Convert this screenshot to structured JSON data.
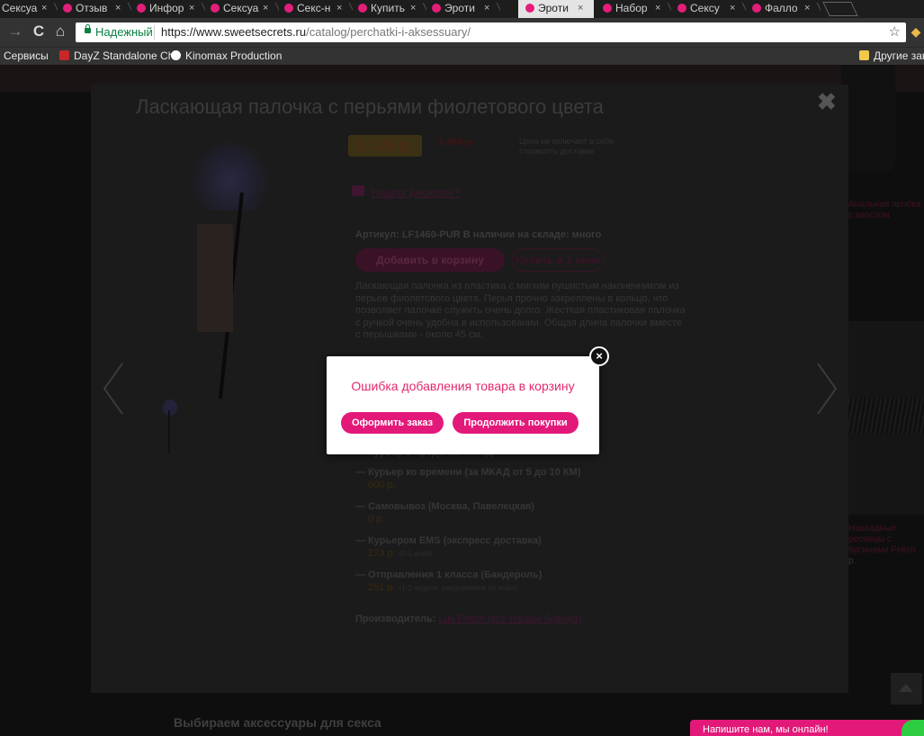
{
  "browser": {
    "tabs": [
      {
        "label": "Сексуа",
        "active": false
      },
      {
        "label": "Отзыв",
        "active": false
      },
      {
        "label": "Инфор",
        "active": false
      },
      {
        "label": "Сексуа",
        "active": false
      },
      {
        "label": "Секс-н",
        "active": false
      },
      {
        "label": "Купить",
        "active": false
      },
      {
        "label": "Эроти",
        "active": false
      },
      {
        "label": "Эроти",
        "active": true
      },
      {
        "label": "Набор",
        "active": false
      },
      {
        "label": "Сексу",
        "active": false
      },
      {
        "label": "Фалло",
        "active": false
      }
    ],
    "tab_close_glyph": "×",
    "nav": {
      "back": "→",
      "reload": "C",
      "home": "⌂"
    },
    "address": {
      "secure_label": "Надежный",
      "url_host": "https://www.sweetsecrets.ru",
      "url_path": "/catalog/perchatki-i-aksessuary/",
      "star": "☆"
    },
    "bookmarks": [
      {
        "label": "Сервисы",
        "icon": "apps-icon",
        "color": "#333333"
      },
      {
        "label": "DayZ Standalone Che",
        "icon": "dayz-icon",
        "color": "#c62828"
      },
      {
        "label": "Kinomax Production",
        "icon": "kinomax-icon",
        "color": "#ffffff"
      }
    ],
    "other_bookmarks": "Другие закл"
  },
  "quickview": {
    "title": "Ласкающая палочка с перьями фиолетового цвета",
    "close_glyph": "✖",
    "price": "1 125 р.",
    "old_price": "1 250 р.",
    "price_note": "Цена не включает в себя стоимость доставки",
    "cheaper_link": "Нашли дешевле?",
    "article": "Артикул: LF1460-PUR   В наличии на складе: много",
    "add_to_cart": "Добавить в корзину",
    "buy_one_click": "Купить в 1 клик",
    "description": "Ласкающая палочка из пластика с мягким пушистым наконечником из перьев фиолетового цвета. Перья прочно закреплены в кольцо, что позволяет палочке служить очень долго. Жесткая пластиковая палочка с ручкой очень удобна в использовании. Общая длина палочки вместе с перышками - около 45 см.",
    "delivery_partial": "— Курьер в пределах МКАД",
    "delivery": [
      {
        "name": "— Курьер ко времени (за МКАД от 5 до 10 КМ)",
        "price": "600 р.",
        "note": ""
      },
      {
        "name": "— Самовывоз (Москва, Павелецкая)",
        "price": "0 р.",
        "note": ""
      },
      {
        "name": "— Курьером EMS (экспресс доставка)",
        "price": "273 р.",
        "note": "(0-0 дней)"
      },
      {
        "name": "— Отправления 1 класса (Бандероль)",
        "price": "251 р.",
        "note": "(1-2 недели, уведомление по мэйл)"
      }
    ],
    "maker_label": "Производитель:",
    "maker_link": "Lux Fetish (все товары бренда)"
  },
  "popup": {
    "message": "Ошибка добавления товара в корзину",
    "checkout": "Оформить заказ",
    "continue": "Продолжить покупки",
    "close_glyph": "×"
  },
  "page": {
    "right_link": "Анальная пробка с хвостом",
    "right_link2": "Накладные ресницы с бусинами Fetish",
    "right_note": "р.",
    "bottom_heading": "Выбираем аксессуары для секса",
    "chat": "Напишите нам, мы онлайн!"
  },
  "colors": {
    "accent": "#e3197a",
    "secure": "#0b8043",
    "error_text": "#e3276f"
  }
}
